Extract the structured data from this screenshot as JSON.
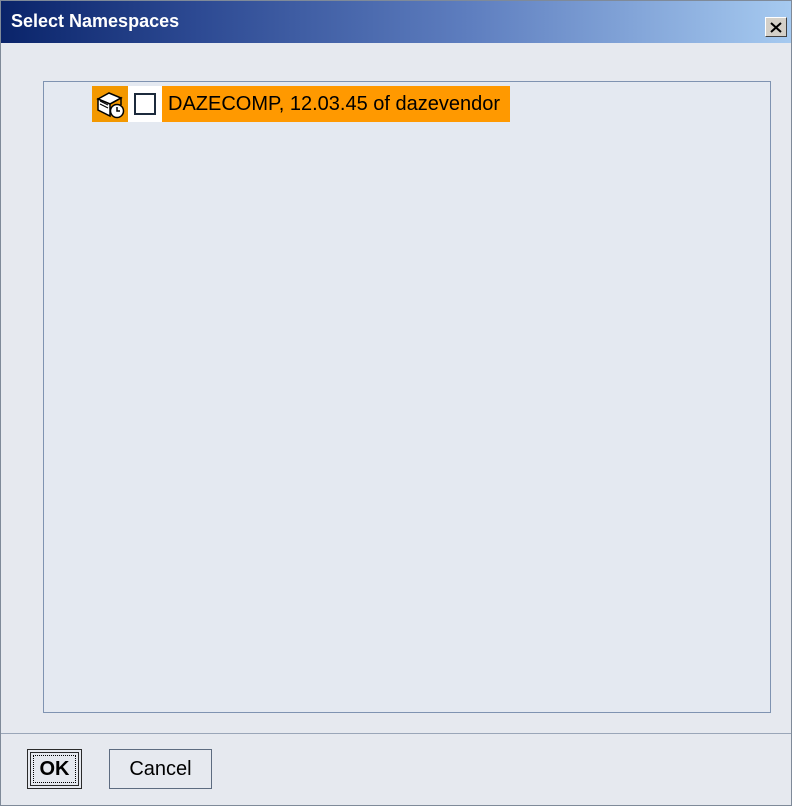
{
  "window": {
    "title": "Select Namespaces",
    "close_label": "X"
  },
  "tree": {
    "items": [
      {
        "label": "DAZECOMP, 12.03.45 of dazevendor",
        "icon": "component-package-icon",
        "checked": false,
        "selected": true
      }
    ]
  },
  "buttons": {
    "ok_label": "OK",
    "cancel_label": "Cancel"
  },
  "colors": {
    "title_bar_start": "#0a246a",
    "title_bar_end": "#a6caf0",
    "selection": "#ff9900",
    "panel_background": "#e4e9f1"
  }
}
